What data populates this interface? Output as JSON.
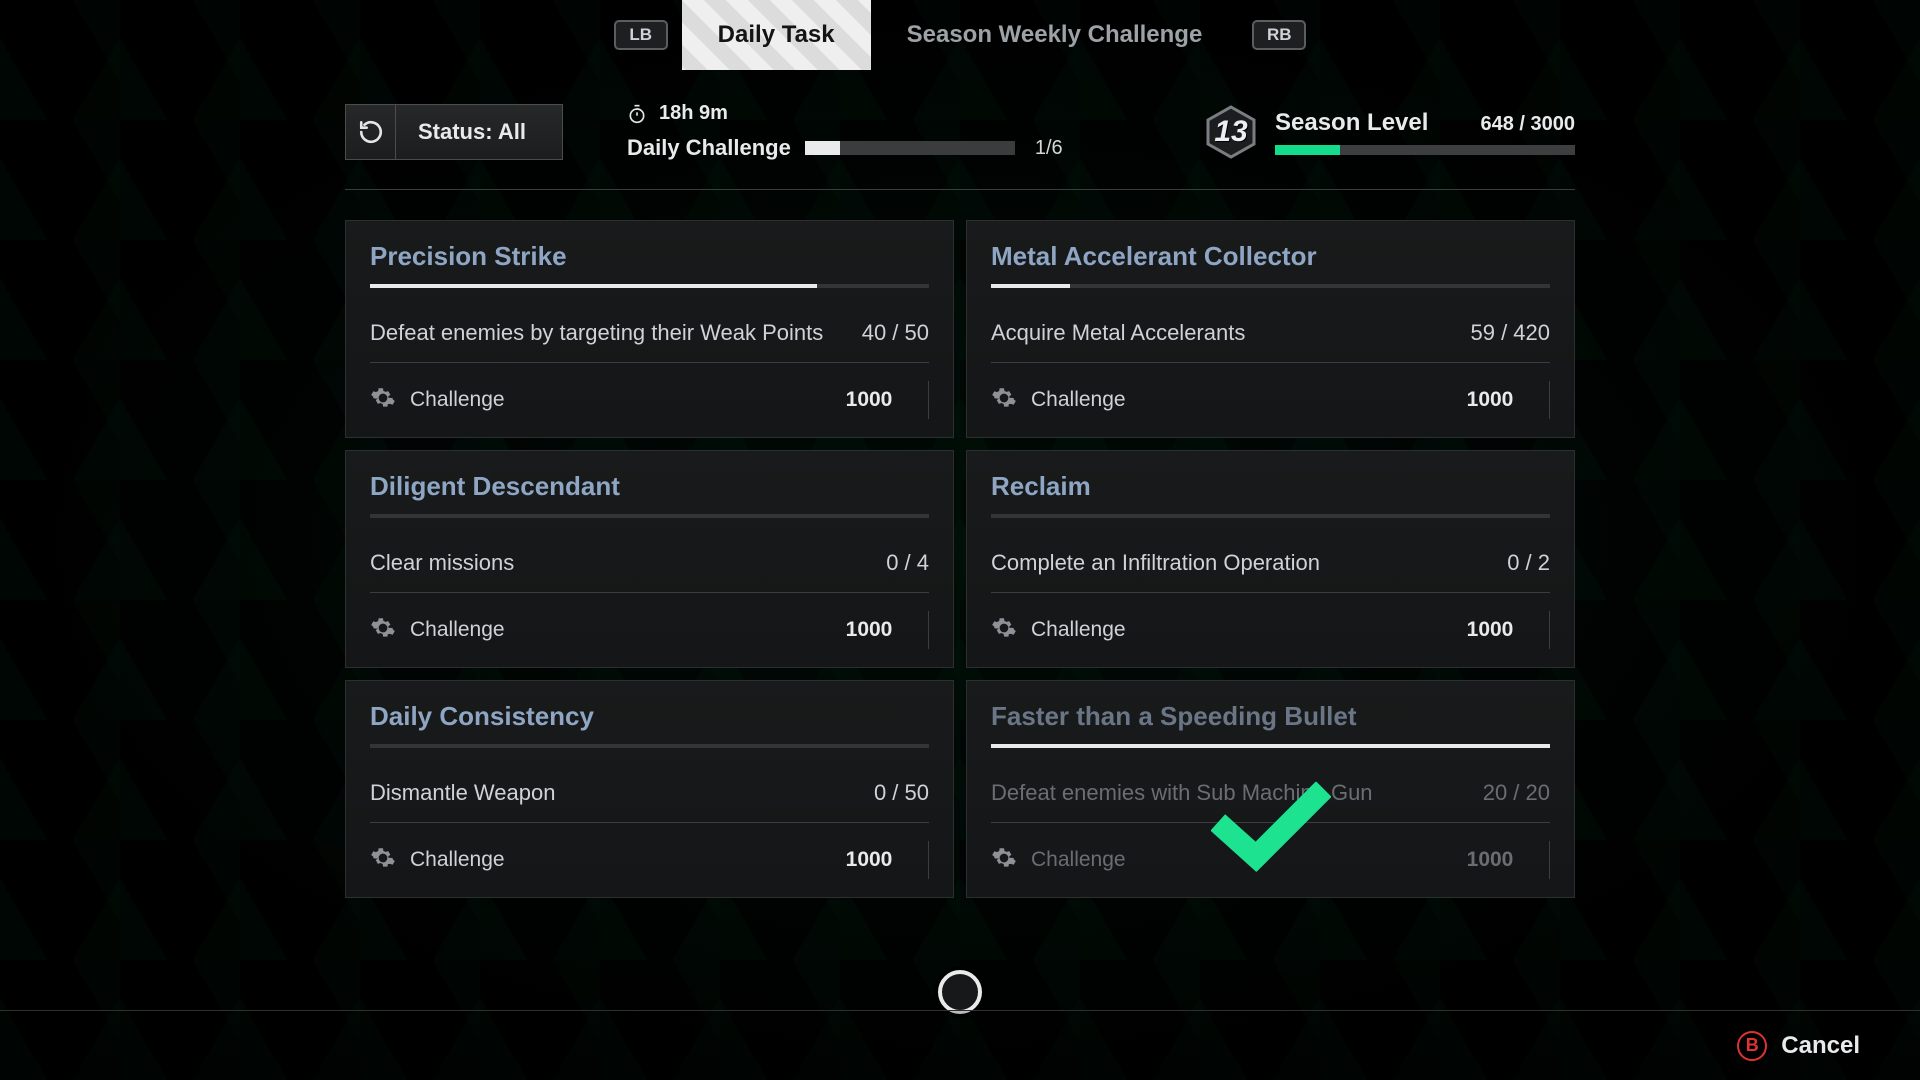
{
  "tabs": {
    "lb": "LB",
    "rb": "RB",
    "daily": "Daily Task",
    "weekly": "Season Weekly Challenge"
  },
  "status": {
    "label": "Status: All"
  },
  "daily": {
    "time": "18h 9m",
    "label": "Daily Challenge",
    "done": 1,
    "total": 6,
    "count": "1/6"
  },
  "season": {
    "level": 13,
    "label": "Season Level",
    "xp_cur": 648,
    "xp_max": 3000,
    "xp": "648 / 3000"
  },
  "reward_label": "Challenge",
  "cards": [
    {
      "title": "Precision Strike",
      "objective": "Defeat enemies by targeting their Weak Points",
      "cur": 40,
      "max": 50,
      "progress": "40 / 50",
      "reward": 1000,
      "done": false
    },
    {
      "title": "Metal Accelerant Collector",
      "objective": "Acquire Metal Accelerants",
      "cur": 59,
      "max": 420,
      "progress": "59 / 420",
      "reward": 1000,
      "done": false
    },
    {
      "title": "Diligent Descendant",
      "objective": "Clear missions",
      "cur": 0,
      "max": 4,
      "progress": "0 / 4",
      "reward": 1000,
      "done": false
    },
    {
      "title": "Reclaim",
      "objective": "Complete an Infiltration Operation",
      "cur": 0,
      "max": 2,
      "progress": "0 / 2",
      "reward": 1000,
      "done": false
    },
    {
      "title": "Daily Consistency",
      "objective": "Dismantle Weapon",
      "cur": 0,
      "max": 50,
      "progress": "0 / 50",
      "reward": 1000,
      "done": false
    },
    {
      "title": "Faster than a Speeding Bullet",
      "objective": "Defeat enemies with Sub Machine Gun",
      "cur": 20,
      "max": 20,
      "progress": "20 / 20",
      "reward": 1000,
      "done": true
    }
  ],
  "footer": {
    "b": "B",
    "cancel": "Cancel"
  }
}
